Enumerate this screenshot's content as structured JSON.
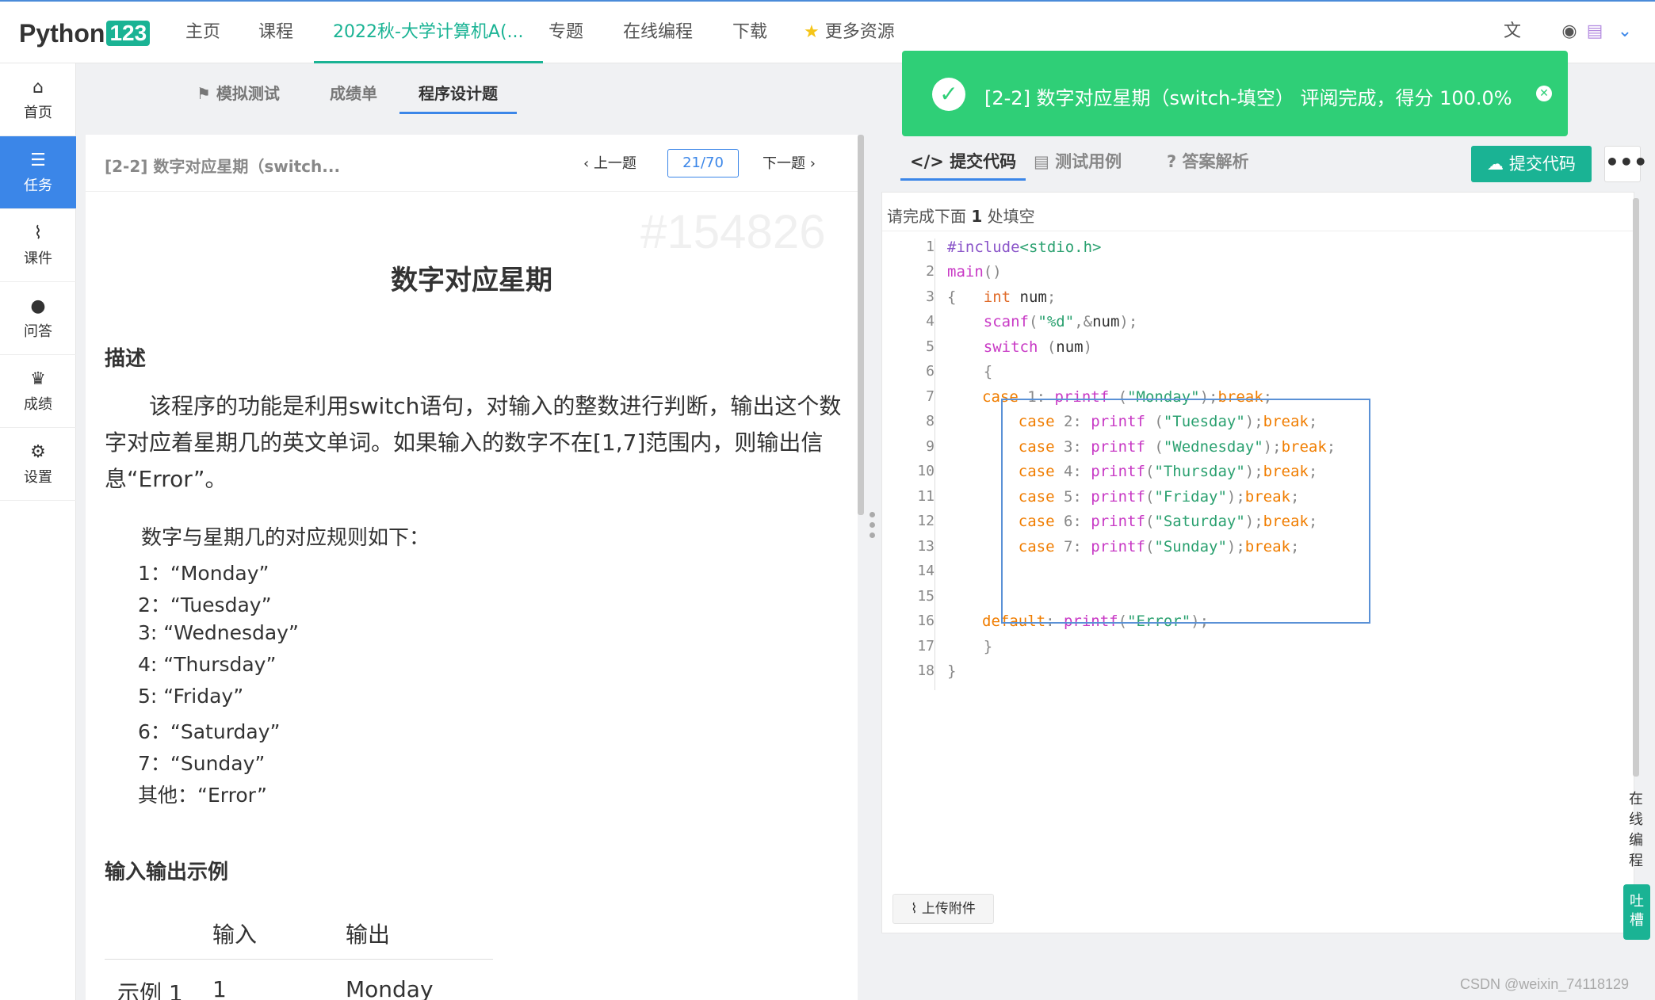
{
  "topnav": {
    "logo_text": "Python",
    "logo_num": "123",
    "items": [
      "主页",
      "课程",
      "2022秋-大学计算机A(...",
      "专题",
      "在线编程",
      "下载",
      "更多资源"
    ]
  },
  "sidebar": {
    "items": [
      {
        "label": "首页",
        "icon": "home-icon"
      },
      {
        "label": "任务",
        "icon": "tasks-icon"
      },
      {
        "label": "课件",
        "icon": "paperclip-icon"
      },
      {
        "label": "问答",
        "icon": "chat-icon"
      },
      {
        "label": "成绩",
        "icon": "trophy-icon"
      },
      {
        "label": "设置",
        "icon": "gear-icon"
      }
    ]
  },
  "subtabs": [
    "模拟测试",
    "成绩单",
    "程序设计题"
  ],
  "problem": {
    "header_title": "[2-2] 数字对应星期（switch...",
    "prev_label": "上一题",
    "page_indicator": "21/70",
    "next_label": "下一题",
    "watermark": "#154826",
    "title": "数字对应星期",
    "desc_heading": "描述",
    "description": "该程序的功能是利用switch语句，对输入的整数进行判断，输出这个数字对应着星期几的英文单词。如果输入的数字不在[1,7]范围内，则输出信息“Error”。",
    "rules_title": "数字与星期几的对应规则如下：",
    "rules": [
      "1：“Monday”",
      "2：“Tuesday”",
      "3: “Wednesday”",
      "4: “Thursday”",
      "5: “Friday”",
      "6：“Saturday”",
      "7：“Sunday”",
      "其他：“Error”"
    ],
    "io_heading": "输入输出示例",
    "io_headers": [
      "输入",
      "输出"
    ],
    "io_rows": [
      [
        "示例 1",
        "1",
        "Monday"
      ]
    ]
  },
  "right": {
    "tabs": [
      "提交代码",
      "测试用例",
      "答案解析"
    ],
    "submit_label": "提交代码",
    "more_label": "•••",
    "fill_hint_pre": "请完成下面",
    "fill_hint_count": "1",
    "fill_hint_post": "处填空",
    "upload_label": "上传附件",
    "side_online": "在线编程",
    "side_complain": "吐槽"
  },
  "code_lines": [
    "1",
    "2",
    "3",
    "4",
    "5",
    "6",
    "7",
    "8",
    "9",
    "10",
    "11",
    "12",
    "13",
    "14",
    "15",
    "16",
    "17",
    "18"
  ],
  "toast": {
    "message": "[2-2] 数字对应星期（switch-填空） 评阅完成，得分 100.0%",
    "color": "#2fcf77"
  },
  "footer_watermark": "CSDN @weixin_74118129",
  "colors": {
    "accent": "#1ab394",
    "blue": "#3b86e8"
  }
}
